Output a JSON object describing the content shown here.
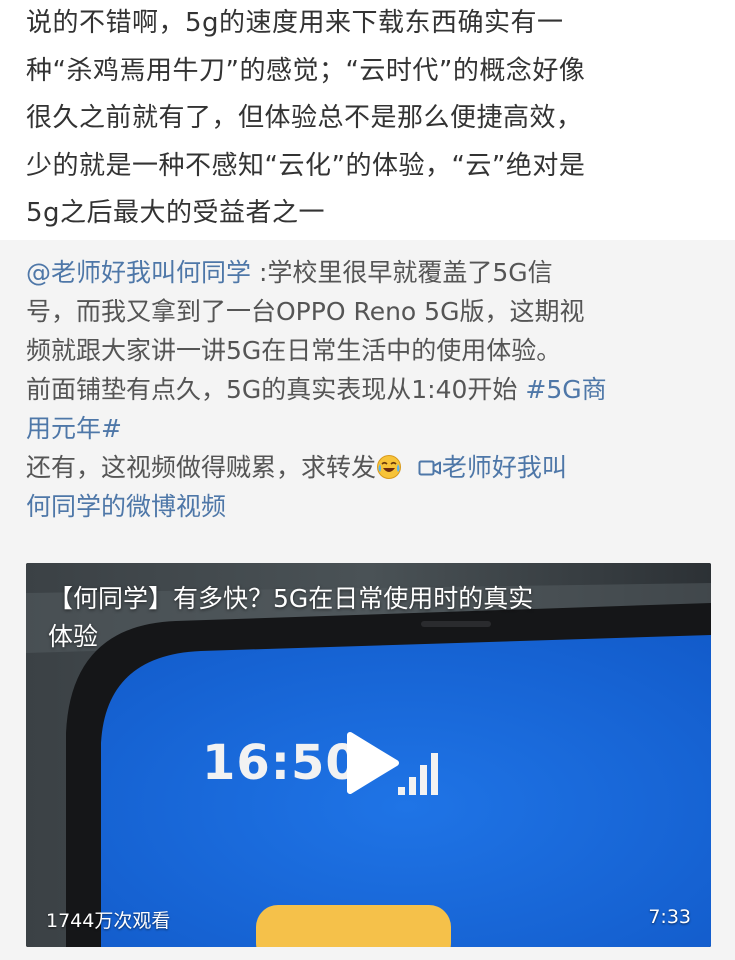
{
  "comment": {
    "lines": [
      "说的不错啊，5g的速度用来下载东西确实有一",
      "种“杀鸡焉用牛刀”的感觉；“云时代”的概念好像",
      "很久之前就有了，但体验总不是那么便捷高效，",
      "少的就是一种不感知“云化”的体验，“云”绝对是",
      "5g之后最大的受益者之一"
    ]
  },
  "repost": {
    "mention": "@老师好我叫何同学",
    "text_1": " :学校里很早就覆盖了5G信",
    "line_2": "号，而我又拿到了一台OPPO Reno 5G版，这期视",
    "line_3": "频就跟大家讲一讲5G在日常生活中的使用体验。",
    "line_4a": "前面铺垫有点久，5G的真实表现从1:40开始 ",
    "hashtag_a": "#5G商",
    "hashtag_b": "用元年#",
    "line_6a": "还有，这视频做得贼累，求转发",
    "emoji_name": "laugh-cry-emoji",
    "video_icon": "video-camera-icon",
    "video_link_a": "老师好我叫",
    "video_link_b": "何同学的微博视频"
  },
  "video": {
    "title_lines": [
      "【何同学】有多快？5G在日常使用时的真实",
      "体验"
    ],
    "clock": "16:50",
    "views": "1744万次观看",
    "duration": "7:33"
  },
  "colors": {
    "link": "#4e77a8",
    "repost_bg": "#f4f4f4",
    "screen_blue": "#1565d8"
  }
}
